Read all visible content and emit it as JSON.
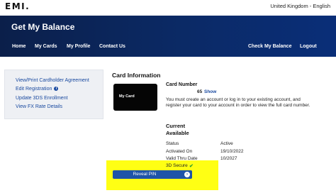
{
  "header": {
    "logo": "EMI.",
    "locale": "United Kingdom - English"
  },
  "banner": {
    "title": "Get My Balance"
  },
  "nav": {
    "items": [
      "Home",
      "My Cards",
      "My Profile",
      "Contact Us"
    ],
    "check_balance": "Check My Balance",
    "logout": "Logout"
  },
  "sidebar": {
    "links": [
      "View/Print Cardholder Agreement",
      "Edit Registration",
      "Update 3DS Enrollment",
      "View FX Rate Details"
    ],
    "info_icon": "i"
  },
  "card_info": {
    "title": "Card Information",
    "card_label": "My Card",
    "card_number_label": "Card Number",
    "card_number": "65",
    "show_link": "Show",
    "message": "You must create an account or log in to your existing account, and register your card to your account in order to view the full card number.",
    "availability_title_1": "Current",
    "availability_title_2": "Available"
  },
  "status": {
    "rows": [
      {
        "label": "Status",
        "value": "Active"
      },
      {
        "label": "Activated On",
        "value": "19/10/2022"
      },
      {
        "label": "Valid Thru Date",
        "value": "10/2027"
      }
    ],
    "secure_label": "3D Secure",
    "secure_icon": "check-icon"
  },
  "actions": {
    "reveal_pin": "Reveal PIN",
    "reveal_icon": "chevron-right-icon"
  },
  "colors": {
    "banner": "#0b2a66",
    "accent": "#1f54a8",
    "highlight": "#ffff14",
    "check": "#2e9e2e"
  }
}
